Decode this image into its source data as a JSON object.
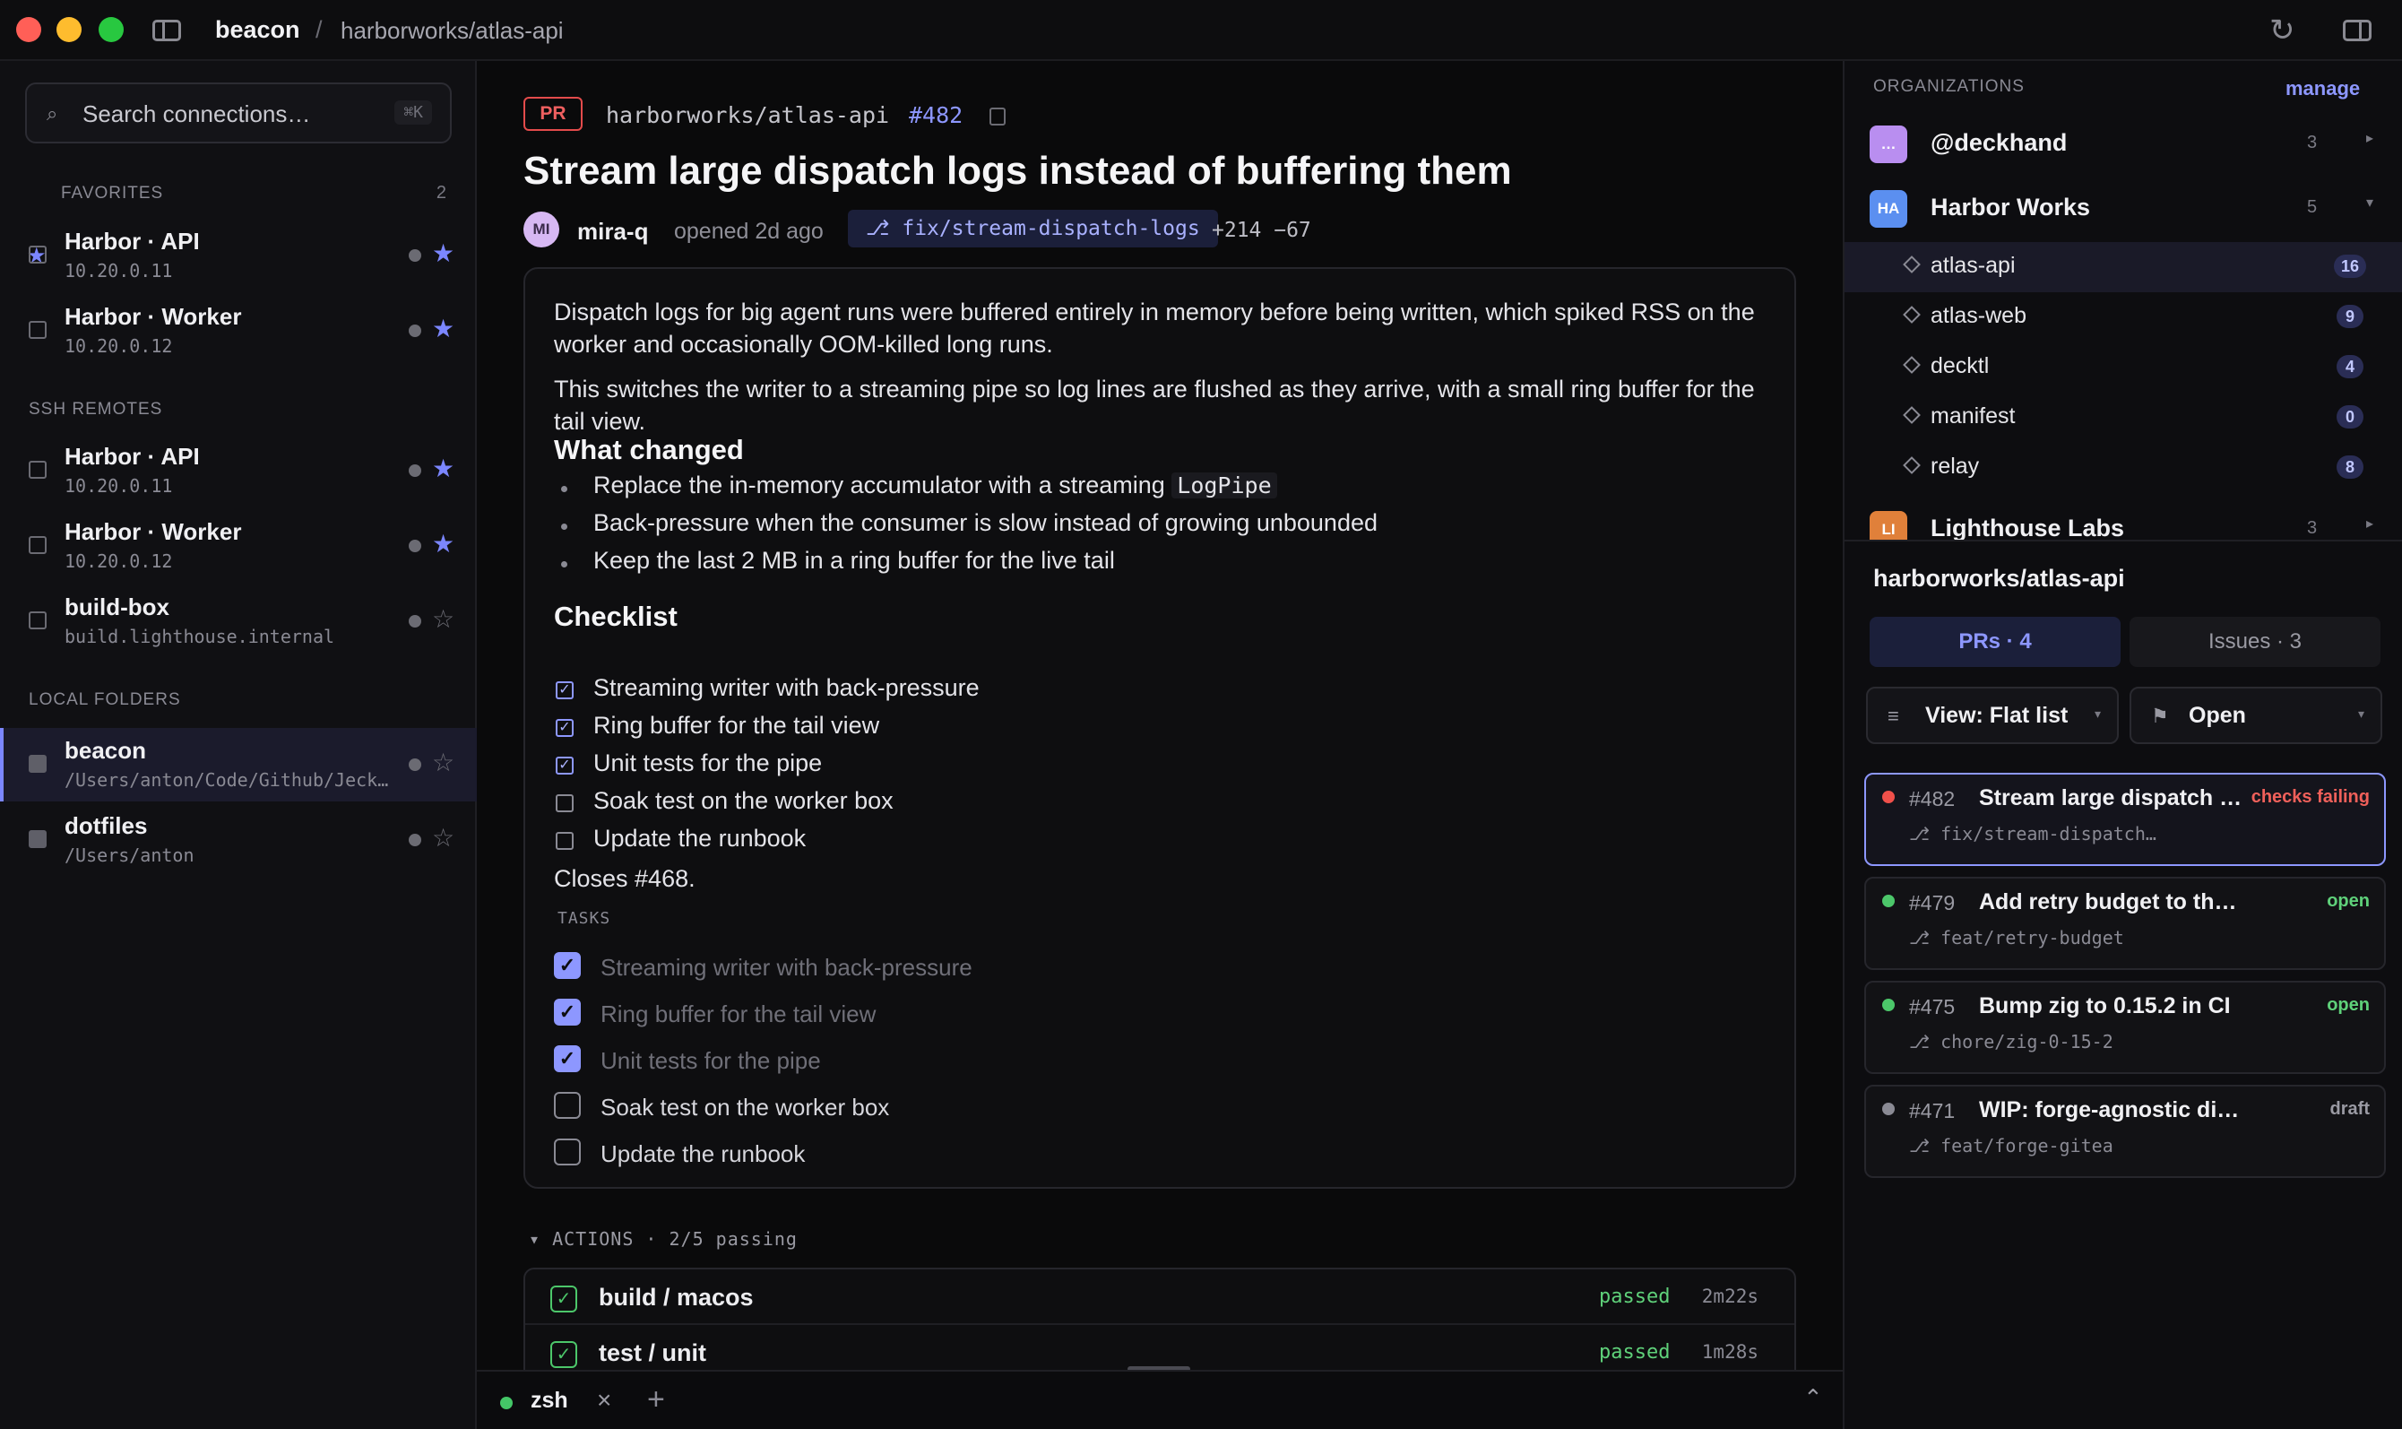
{
  "titlebar": {
    "app": "beacon",
    "separator": "/",
    "repo": "harborworks/atlas-api"
  },
  "sidebar": {
    "search": {
      "placeholder": "Search connections…",
      "shortcut": "⌘K"
    },
    "favorites": {
      "title": "FAVORITES",
      "count": "2",
      "items": [
        {
          "name": "Harbor · API",
          "sub": "10.20.0.11",
          "starred": true
        },
        {
          "name": "Harbor · Worker",
          "sub": "10.20.0.12",
          "starred": true
        }
      ]
    },
    "ssh": {
      "title": "SSH REMOTES",
      "items": [
        {
          "name": "Harbor · API",
          "sub": "10.20.0.11",
          "starred": true
        },
        {
          "name": "Harbor · Worker",
          "sub": "10.20.0.12",
          "starred": true
        },
        {
          "name": "build-box",
          "sub": "build.lighthouse.internal",
          "starred": false
        }
      ]
    },
    "local": {
      "title": "LOCAL FOLDERS",
      "items": [
        {
          "name": "beacon",
          "sub": "/Users/anton/Code/Github/Jeck…",
          "starred": false,
          "active": true
        },
        {
          "name": "dotfiles",
          "sub": "/Users/anton",
          "starred": false
        }
      ]
    }
  },
  "pr": {
    "badge": "PR",
    "repo": "harborworks/atlas-api",
    "number": "#482",
    "title": "Stream large dispatch logs instead of buffering them",
    "author_initials": "MI",
    "author": "mira-q",
    "opened": "opened 2d ago",
    "branch": "⎇ fix/stream-dispatch-logs",
    "diffstat": "+214 −67",
    "body": {
      "p1": "Dispatch logs for big agent runs were buffered entirely in memory before being written, which spiked RSS on the worker and occasionally OOM-killed long runs.",
      "p2": "This switches the writer to a streaming pipe so log lines are flushed as they arrive, with a small ring buffer for the tail view.",
      "what_changed_title": "What changed",
      "changes": [
        {
          "text": "Replace the in-memory accumulator with a streaming ",
          "code": "LogPipe"
        },
        {
          "text": "Back-pressure when the consumer is slow instead of growing unbounded"
        },
        {
          "text": "Keep the last 2 MB in a ring buffer for the live tail"
        }
      ],
      "checklist_title": "Checklist",
      "checklist": [
        {
          "text": "Streaming writer with back-pressure",
          "checked": true
        },
        {
          "text": "Ring buffer for the tail view",
          "checked": true
        },
        {
          "text": "Unit tests for the pipe",
          "checked": true
        },
        {
          "text": "Soak test on the worker box",
          "checked": false
        },
        {
          "text": "Update the runbook",
          "checked": false
        }
      ],
      "closes": "Closes #468.",
      "tasks_title": "TASKS",
      "tasks": [
        {
          "text": "Streaming writer with back-pressure",
          "checked": true
        },
        {
          "text": "Ring buffer for the tail view",
          "checked": true
        },
        {
          "text": "Unit tests for the pipe",
          "checked": true
        },
        {
          "text": "Soak test on the worker box",
          "checked": false
        },
        {
          "text": "Update the runbook",
          "checked": false
        }
      ]
    },
    "actions": {
      "header": "▾ ACTIONS · 2/5 passing",
      "runs": [
        {
          "name": "build / macos",
          "status": "passed",
          "time": "2m22s"
        },
        {
          "name": "test / unit",
          "status": "passed",
          "time": "1m28s"
        }
      ]
    }
  },
  "terminal": {
    "tab": "zsh",
    "close": "×",
    "add": "+",
    "toggle": "⌃"
  },
  "right": {
    "orgs_title": "ORGANIZATIONS",
    "manage": "manage",
    "orgs": [
      {
        "initials": "…",
        "name": "@deckhand",
        "count": "3",
        "color": "#b98ef0"
      },
      {
        "initials": "HA",
        "name": "Harbor Works",
        "count": "5",
        "color": "#5b8ff0"
      },
      {
        "initials": "LI",
        "name": "Lighthouse Labs",
        "count": "3",
        "color": "#e0803a"
      }
    ],
    "repos": [
      {
        "name": "atlas-api",
        "count": "16",
        "selected": true
      },
      {
        "name": "atlas-web",
        "count": "9"
      },
      {
        "name": "decktl",
        "count": "4"
      },
      {
        "name": "manifest",
        "count": "0"
      },
      {
        "name": "relay",
        "count": "8"
      }
    ],
    "repo_title": "harborworks/atlas-api",
    "tabs": {
      "prs": "PRs · 4",
      "issues": "Issues · 3"
    },
    "view": {
      "icon": "≡",
      "label": "View: Flat list"
    },
    "filter": {
      "icon": "⚑",
      "label": "Open"
    },
    "prs": [
      {
        "num": "#482",
        "title": "Stream large dispatch logs instead of buffering them",
        "status": "checks failing",
        "branch": "⎇ fix/stream-dispatch…",
        "dot": "#f0504a",
        "status_color": "#f0605a",
        "selected": true
      },
      {
        "num": "#479",
        "title": "Add retry budget to the dispatcher",
        "status": "open",
        "branch": "⎇ feat/retry-budget",
        "dot": "#4cc76a",
        "status_color": "#5fd17a"
      },
      {
        "num": "#475",
        "title": "Bump zig to 0.15.2 in CI",
        "status": "open",
        "branch": "⎇ chore/zig-0-15-2",
        "dot": "#4cc76a",
        "status_color": "#5fd17a"
      },
      {
        "num": "#471",
        "title": "WIP: forge-agnostic dispatch",
        "status": "draft",
        "branch": "⎇ feat/forge-gitea",
        "dot": "#8a8a94",
        "status_color": "#9a9aa3"
      }
    ]
  }
}
